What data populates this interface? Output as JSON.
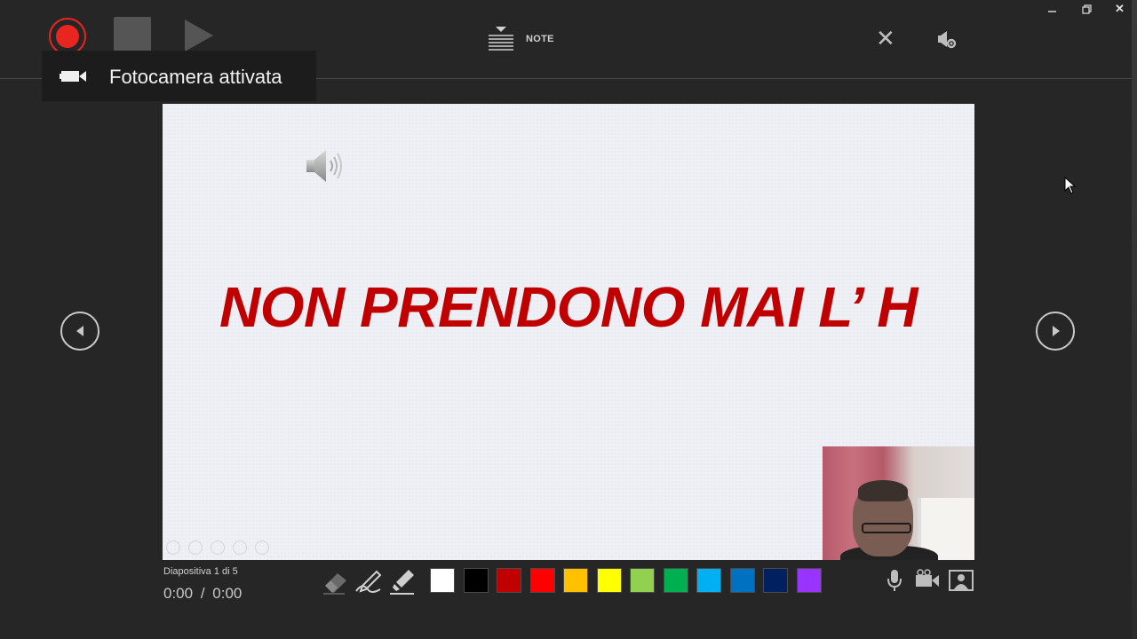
{
  "toolbar": {
    "notes_label": "NOTE"
  },
  "toast": {
    "message": "Fotocamera attivata"
  },
  "slide": {
    "title": "NON PRENDONO MAI L’ H",
    "title_color": "#c00000"
  },
  "status": {
    "slide_counter": "Diapositiva 1 di 5",
    "time_current": "0:00",
    "time_separator": "/",
    "time_total": "0:00"
  },
  "ink_colors": [
    "#ffffff",
    "#000000",
    "#c00000",
    "#ff0000",
    "#ffc000",
    "#ffff00",
    "#92d050",
    "#00b050",
    "#00b0f0",
    "#0070c0",
    "#002060",
    "#9933ff"
  ],
  "icons": {
    "record": "record-icon",
    "stop": "stop-icon",
    "play": "play-icon",
    "notes": "notes-icon",
    "close": "close-icon",
    "settings": "settings-icon",
    "camera": "video-camera-icon",
    "speaker": "speaker-icon",
    "eraser": "eraser-icon",
    "pen": "pen-icon",
    "highlighter": "highlighter-icon",
    "microphone": "microphone-icon",
    "camera_toggle": "camera-toggle-icon",
    "camera_preview": "camera-preview-icon"
  },
  "accent_color": "#e8261f"
}
